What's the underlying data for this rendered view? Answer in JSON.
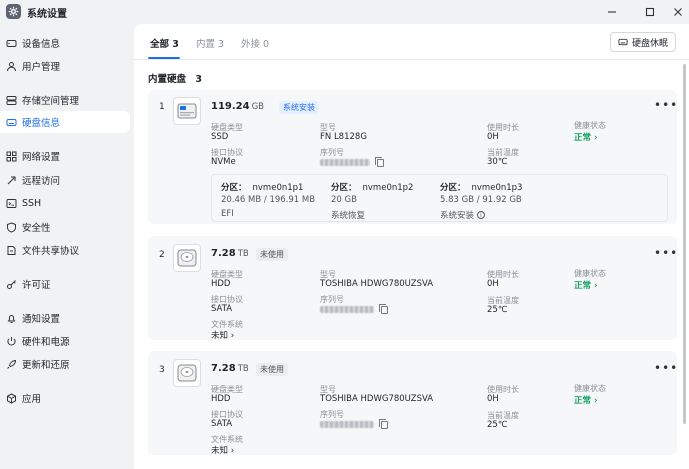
{
  "app": {
    "title": "系统设置"
  },
  "sidebar": {
    "items": [
      {
        "label": "设备信息",
        "icon": "device-icon"
      },
      {
        "label": "用户管理",
        "icon": "user-icon"
      },
      {
        "label": "存储空间管理",
        "icon": "storage-icon"
      },
      {
        "label": "硬盘信息",
        "icon": "disk-icon",
        "active": true
      },
      {
        "label": "网络设置",
        "icon": "network-icon"
      },
      {
        "label": "远程访问",
        "icon": "remote-icon"
      },
      {
        "label": "SSH",
        "icon": "terminal-icon"
      },
      {
        "label": "安全性",
        "icon": "shield-icon"
      },
      {
        "label": "文件共享协议",
        "icon": "share-icon"
      },
      {
        "label": "许可证",
        "icon": "key-icon"
      },
      {
        "label": "通知设置",
        "icon": "bell-icon"
      },
      {
        "label": "硬件和电源",
        "icon": "power-icon"
      },
      {
        "label": "更新和还原",
        "icon": "rocket-icon"
      },
      {
        "label": "应用",
        "icon": "apps-icon"
      }
    ]
  },
  "tabs": [
    {
      "label": "全部 3",
      "active": true
    },
    {
      "label": "内置 3"
    },
    {
      "label": "外接 0"
    }
  ],
  "toolbar": {
    "sleep_label": "硬盘休眠"
  },
  "section": {
    "title": "内置硬盘",
    "count": "3"
  },
  "labels": {
    "disk_type": "硬盘类型",
    "interface": "接口协议",
    "model": "型号",
    "serial": "序列号",
    "filesystem": "文件系统",
    "hours": "使用时长",
    "temp": "当前温度",
    "health": "健康状态",
    "partition": "分区：",
    "more": "•••"
  },
  "disks": [
    {
      "index": "1",
      "capacity": "119.24",
      "unit": "GB",
      "badge": "系统安装",
      "type": "SSD",
      "interface": "NVMe",
      "model": "FN L8128G",
      "hours": "0H",
      "temp": "30℃",
      "health": "正常 ›",
      "partitions": [
        {
          "name": "nvme0n1p1",
          "size": "20.46 MB / 196.91 MB",
          "label": "EFI"
        },
        {
          "name": "nvme0n1p2",
          "size": "20 GB",
          "label": "系统恢复"
        },
        {
          "name": "nvme0n1p3",
          "size": "5.83 GB / 91.92 GB",
          "label": "系统安装"
        }
      ]
    },
    {
      "index": "2",
      "capacity": "7.28",
      "unit": "TB",
      "badge": "未使用",
      "type": "HDD",
      "interface": "SATA",
      "model": "TOSHIBA HDWG780UZSVA",
      "filesystem": "未知 ›",
      "hours": "0H",
      "temp": "25℃",
      "health": "正常 ›"
    },
    {
      "index": "3",
      "capacity": "7.28",
      "unit": "TB",
      "badge": "未使用",
      "type": "HDD",
      "interface": "SATA",
      "model": "TOSHIBA HDWG780UZSVA",
      "filesystem": "未知 ›",
      "hours": "0H",
      "temp": "25℃",
      "health": "正常 ›"
    }
  ],
  "colors": {
    "accent": "#1f6feb",
    "healthy": "#13a05f"
  }
}
